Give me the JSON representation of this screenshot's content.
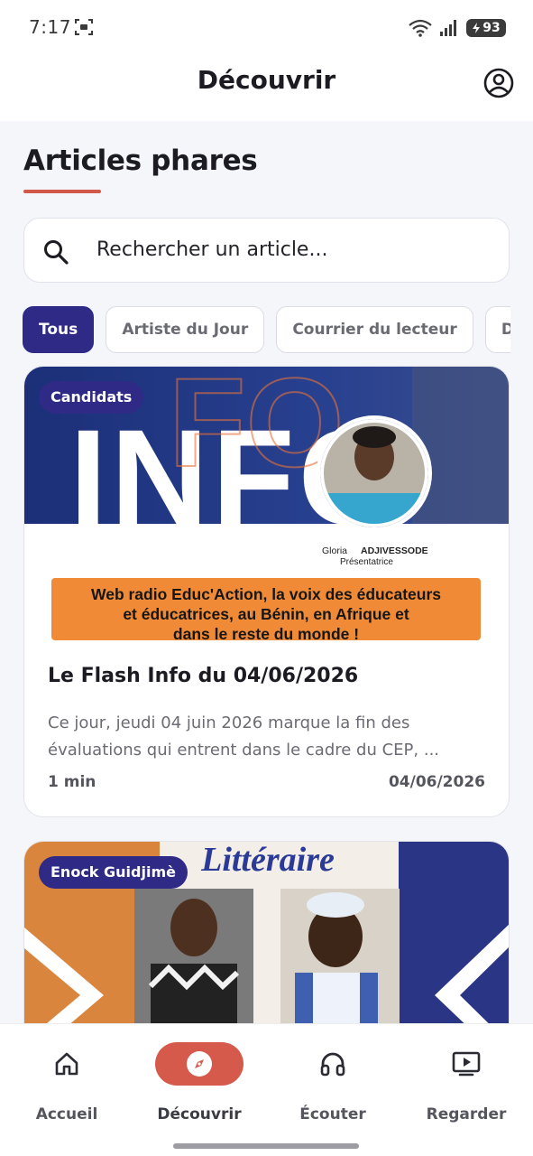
{
  "status_bar": {
    "time": "7:17",
    "battery": "93"
  },
  "app_bar": {
    "title": "Découvrir"
  },
  "section": {
    "title": "Articles phares"
  },
  "search": {
    "placeholder": "Rechercher un article..."
  },
  "chips": [
    "Tous",
    "Artiste du Jour",
    "Courrier du lecteur",
    "Dialo"
  ],
  "articles": [
    {
      "tag": "Candidats",
      "title": "Le Flash Info du 04/06/2026",
      "excerpt": "Ce jour, jeudi 04 juin 2026 marque la fin des évaluations qui entrent dans le cadre du CEP, ...",
      "read_time": "1 min",
      "date": "04/06/2026",
      "image": {
        "big_text": "INFO",
        "presenter_first": "Gloria",
        "presenter_last": "ADJIVESSODE",
        "presenter_role": "Présentatrice",
        "banner_line1": "Web radio Educ'Action, la voix des éducateurs",
        "banner_line2": "et éducatrices, au Bénin, en Afrique et",
        "banner_line3": "dans le reste du monde !"
      }
    },
    {
      "tag": "Enock Guidjimè",
      "image": {
        "heading": "Littéraire"
      }
    }
  ],
  "bottom_nav": [
    {
      "label": "Accueil",
      "icon": "home-icon"
    },
    {
      "label": "Découvrir",
      "icon": "compass-icon",
      "active": true
    },
    {
      "label": "Écouter",
      "icon": "headphones-icon"
    },
    {
      "label": "Regarder",
      "icon": "play-screen-icon"
    }
  ],
  "colors": {
    "accent": "#d65a4c",
    "primary": "#2e2a86",
    "orange_banner": "#f08a36"
  }
}
